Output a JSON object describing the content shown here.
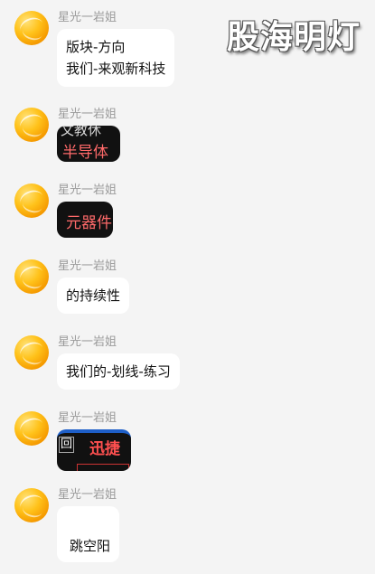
{
  "watermark": "股海明灯",
  "messages": [
    {
      "sender": "星光一岩姐",
      "lines": [
        "版块-方向",
        "我们-来观新科技"
      ]
    },
    {
      "sender": "星光一岩姐",
      "sticker": {
        "top_text": "文教休",
        "main_text": "半导体"
      }
    },
    {
      "sender": "星光一岩姐",
      "sticker": {
        "main_text": "元器件"
      }
    },
    {
      "sender": "星光一岩姐",
      "lines": [
        "的持续性"
      ]
    },
    {
      "sender": "星光一岩姐",
      "lines": [
        "我们的-划线-练习"
      ]
    },
    {
      "sender": "星光一岩姐",
      "sticker": {
        "left_text": "回",
        "main_text": "迅捷"
      }
    },
    {
      "sender": "星光一岩姐",
      "lines": [
        "跳空阳"
      ]
    }
  ],
  "colors": {
    "sticker_text": "#ff6a6a",
    "sticker_bg": "#111111"
  }
}
